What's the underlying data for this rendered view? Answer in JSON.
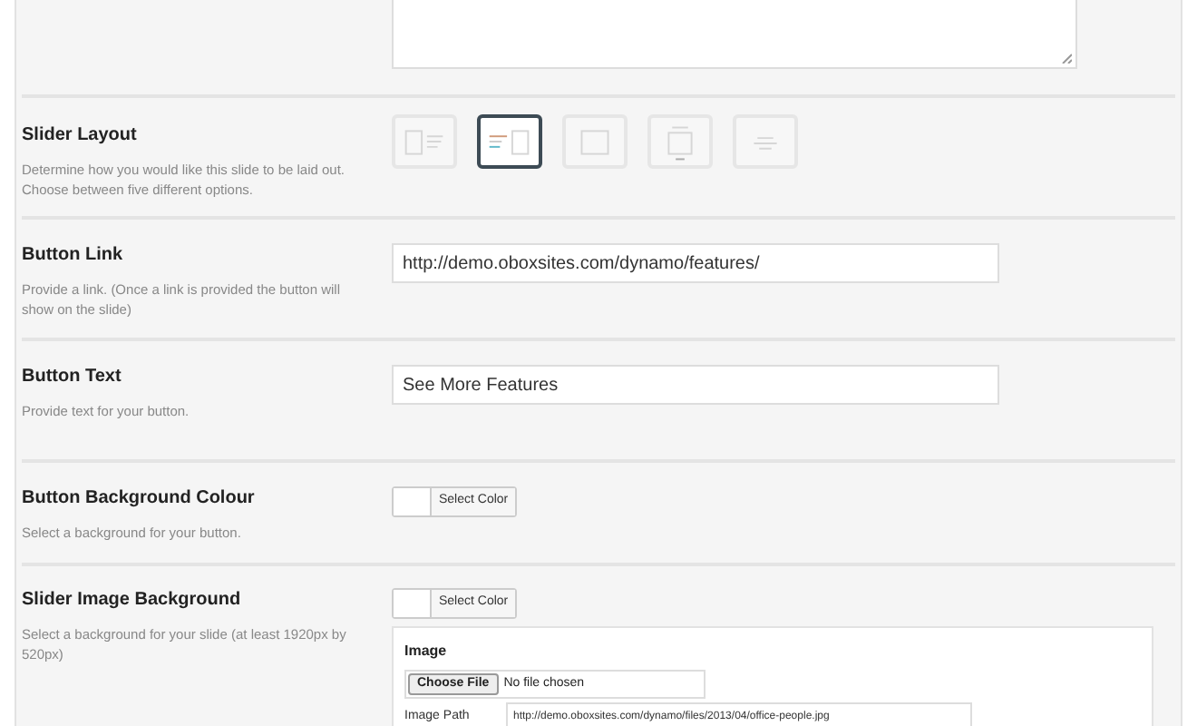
{
  "top_field": {
    "kind": "textarea"
  },
  "settings": [
    {
      "kind": "layout",
      "title": "Slider Layout",
      "description": "Determine how you would like this slide to be laid out. Choose between five different options.",
      "options": [
        {
          "kind": "image-left",
          "selected": false
        },
        {
          "kind": "text-left",
          "selected": true
        },
        {
          "kind": "image-only",
          "selected": false
        },
        {
          "kind": "image-center",
          "selected": false
        },
        {
          "kind": "text-only",
          "selected": false
        }
      ]
    },
    {
      "kind": "text",
      "title": "Button Link",
      "description": "Provide a link. (Once a link is provided the button will show on the slide)",
      "value": "http://demo.oboxsites.com/dynamo/features/"
    },
    {
      "kind": "text",
      "title": "Button Text",
      "description": "Provide text for your button.",
      "value": "See More Features"
    },
    {
      "kind": "color",
      "title": "Button Background Colour",
      "description": "Select a background for your button.",
      "button": "Select Color"
    },
    {
      "kind": "image",
      "title": "Slider Image Background",
      "description": "Select a background for your slide (at least 1920px by 520px)",
      "button": "Select Color",
      "image": {
        "heading": "Image",
        "file_button": "Choose File",
        "file_status": "No file chosen",
        "path_label": "Image Path",
        "path_value": "http://demo.oboxsites.com/dynamo/files/2013/04/office-people.jpg"
      }
    }
  ]
}
